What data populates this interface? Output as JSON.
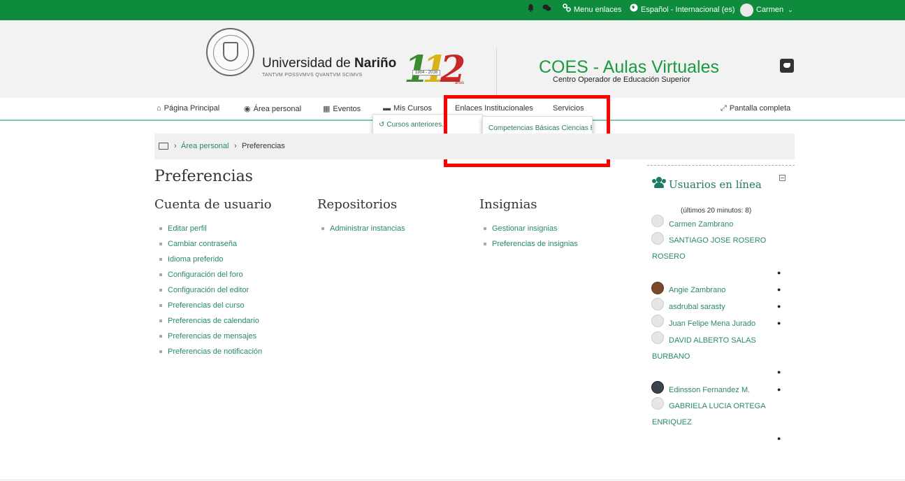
{
  "topbar": {
    "menu_links": "Menu enlaces",
    "language": "Español - Internacional (es)",
    "user_name": "Carmen"
  },
  "header": {
    "uni_name_prefix": "Universidad de ",
    "uni_name_bold": "Nariño",
    "uni_motto": "TANTVM POSSVMVS QVANTVM SCIMVS",
    "anniversary_number": "112",
    "anniversary_years": "1904 - 2016",
    "anniversary_label": "años",
    "site_title": "COES - Aulas Virtuales",
    "site_subtitle": "Centro Operador de Educación Superior"
  },
  "nav": {
    "items": [
      {
        "label": "Página Principal"
      },
      {
        "label": "Área personal"
      },
      {
        "label": "Eventos"
      },
      {
        "label": "Mis Cursos"
      },
      {
        "label": "Enlaces Institucionales"
      },
      {
        "label": "Servicios"
      }
    ],
    "fullscreen": "Pantalla completa"
  },
  "dropdowns": {
    "mis_cursos_item": "Cursos anteriores...",
    "enlaces_item": "Competencias Básicas Ciencias Ex..."
  },
  "breadcrumb": {
    "items": [
      "Área personal",
      "Preferencias"
    ],
    "separator": "›"
  },
  "page": {
    "title": "Preferencias",
    "columns": [
      {
        "title": "Cuenta de usuario",
        "links": [
          "Editar perfil",
          "Cambiar contraseña",
          "Idioma preferido",
          "Configuración del foro",
          "Configuración del editor",
          "Preferencias del curso",
          "Preferencias de calendario",
          "Preferencias de mensajes",
          "Preferencias de notificación"
        ]
      },
      {
        "title": "Repositorios",
        "links": [
          "Administrar instancias"
        ]
      },
      {
        "title": "Insignias",
        "links": [
          "Gestionar insignias",
          "Preferencias de insignias"
        ]
      }
    ]
  },
  "online_block": {
    "title": "Usuarios en línea",
    "subtitle": "(últimos 20 minutos: 8)",
    "users": [
      {
        "line1": "Carmen Zambrano",
        "line2": ""
      },
      {
        "line1": "SANTIAGO JOSE ROSERO",
        "line2": "ROSERO"
      },
      {
        "line1": "Angie Zambrano",
        "line2": ""
      },
      {
        "line1": "asdrubal sarasty",
        "line2": ""
      },
      {
        "line1": "Juan Felipe Mena Jurado",
        "line2": ""
      },
      {
        "line1": "DAVID ALBERTO SALAS",
        "line2": "BURBANO"
      },
      {
        "line1": "Edinsson Fernandez M.",
        "line2": ""
      },
      {
        "line1": "GABRIELA LUCIA ORTEGA",
        "line2": "ENRIQUEZ"
      }
    ]
  },
  "colors": {
    "topbar": "#0e8b3c",
    "link": "#2a8a5e",
    "highlight": "#ff0000",
    "title_green": "#1b9a3e"
  }
}
